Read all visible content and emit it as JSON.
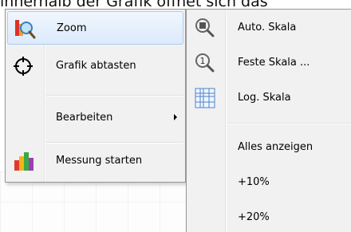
{
  "caption": "innerhalb der Grafik öffnet sich das",
  "context_menu": {
    "items": [
      {
        "label": "Zoom",
        "icon": "zoom-chart-icon",
        "has_submenu": true,
        "highlighted": true
      },
      {
        "label": "Grafik abtasten",
        "icon": "crosshair-icon",
        "has_submenu": false
      },
      {
        "label": "Bearbeiten",
        "icon": "",
        "has_submenu": true
      },
      {
        "label": "Messung starten",
        "icon": "bar-chart-icon",
        "has_submenu": false
      }
    ]
  },
  "zoom_submenu": {
    "items": [
      {
        "label": "Auto. Skala",
        "icon": "auto-scale-icon"
      },
      {
        "label": "Feste Skala ...",
        "icon": "fixed-scale-icon"
      },
      {
        "label": "Log. Skala",
        "icon": "log-scale-grid-icon"
      },
      {
        "label": "Alles anzeigen",
        "icon": ""
      },
      {
        "label": "+10%",
        "icon": ""
      },
      {
        "label": "+20%",
        "icon": ""
      }
    ]
  },
  "colors": {
    "menu_background": "#f1f1f1",
    "highlight_background": "#dceafb",
    "highlight_border": "#aeccf1"
  }
}
